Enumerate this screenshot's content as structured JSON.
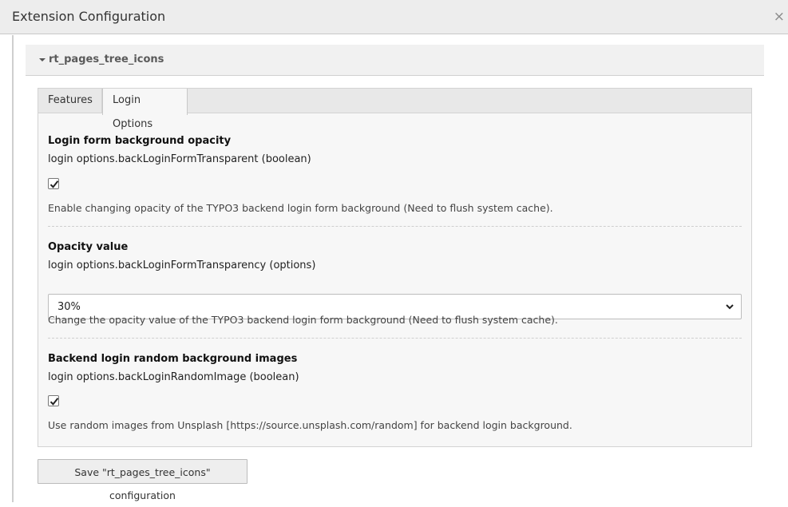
{
  "window": {
    "title": "Extension Configuration",
    "close_glyph": "×"
  },
  "extension": {
    "name": "rt_pages_tree_icons"
  },
  "tabs": [
    {
      "label": "Features",
      "active": false
    },
    {
      "label": "Login Options",
      "active": true
    }
  ],
  "fields": [
    {
      "label": "Login form background opacity",
      "key": "login options.backLoginFormTransparent (boolean)",
      "type": "checkbox",
      "checked": true,
      "description": "Enable changing opacity of the TYPO3 backend login form background (Need to flush system cache)."
    },
    {
      "label": "Opacity value",
      "key": "login options.backLoginFormTransparency (options)",
      "type": "select",
      "value": "30%",
      "description": "Change the opacity value of the TYPO3 backend login form background (Need to flush system cache)."
    },
    {
      "label": "Backend login random background images",
      "key": "login options.backLoginRandomImage (boolean)",
      "type": "checkbox",
      "checked": true,
      "description": "Use random images from Unsplash [https://source.unsplash.com/random] for backend login background."
    }
  ],
  "save_button": {
    "label": "Save \"rt_pages_tree_icons\" configuration"
  }
}
